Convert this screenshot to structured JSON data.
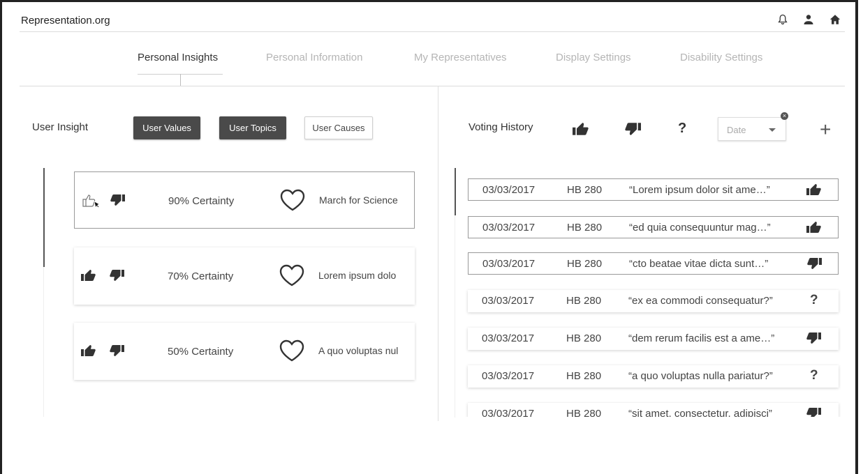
{
  "app": {
    "title": "Representation.org"
  },
  "header": {
    "icons": [
      "bell-icon",
      "person-icon",
      "home-icon"
    ]
  },
  "tabs": [
    {
      "label": "Personal Insights",
      "active": true
    },
    {
      "label": "Personal Information",
      "active": false
    },
    {
      "label": "My Representatives",
      "active": false
    },
    {
      "label": "Display Settings",
      "active": false
    },
    {
      "label": "Disability Settings",
      "active": false
    }
  ],
  "insight": {
    "label": "User Insight",
    "buttons": [
      {
        "label": "User Values",
        "selected": true
      },
      {
        "label": "User Topics",
        "selected": true
      },
      {
        "label": "User Causes",
        "selected": false
      }
    ],
    "cards": [
      {
        "certainty": "90% Certainty",
        "topic": "March for Science"
      },
      {
        "certainty": "70% Certainty",
        "topic": "Lorem ipsum dolo"
      },
      {
        "certainty": "50% Certainty",
        "topic": "A quo voluptas nul"
      }
    ]
  },
  "voting": {
    "label": "Voting History",
    "filters": [
      "thumbs-up-icon",
      "thumbs-down-icon",
      "?"
    ],
    "date_placeholder": "Date",
    "add_label": "+",
    "rows": [
      {
        "date": "03/03/2017",
        "bill": "HB 280",
        "text": "“Lorem ipsum dolor sit ame…”",
        "vote": "up"
      },
      {
        "date": "03/03/2017",
        "bill": "HB 280",
        "text": "“ed quia consequuntur mag…”",
        "vote": "up"
      },
      {
        "date": "03/03/2017",
        "bill": "HB 280",
        "text": "“cto beatae vitae dicta sunt…”",
        "vote": "down"
      },
      {
        "date": "03/03/2017",
        "bill": "HB 280",
        "text": "“ex ea commodi consequatur?”",
        "vote": "?"
      },
      {
        "date": "03/03/2017",
        "bill": "HB 280",
        "text": "“dem rerum facilis est a ame…”",
        "vote": "down"
      },
      {
        "date": "03/03/2017",
        "bill": "HB 280",
        "text": "“a quo voluptas nulla pariatur?”",
        "vote": "?"
      },
      {
        "date": "03/03/2017",
        "bill": "HB 280",
        "text": "“sit amet, consectetur, adipisci”",
        "vote": "down"
      }
    ]
  },
  "colors": {
    "dark_button": "#4a4a4a",
    "muted_tab": "#b5b5b5"
  }
}
